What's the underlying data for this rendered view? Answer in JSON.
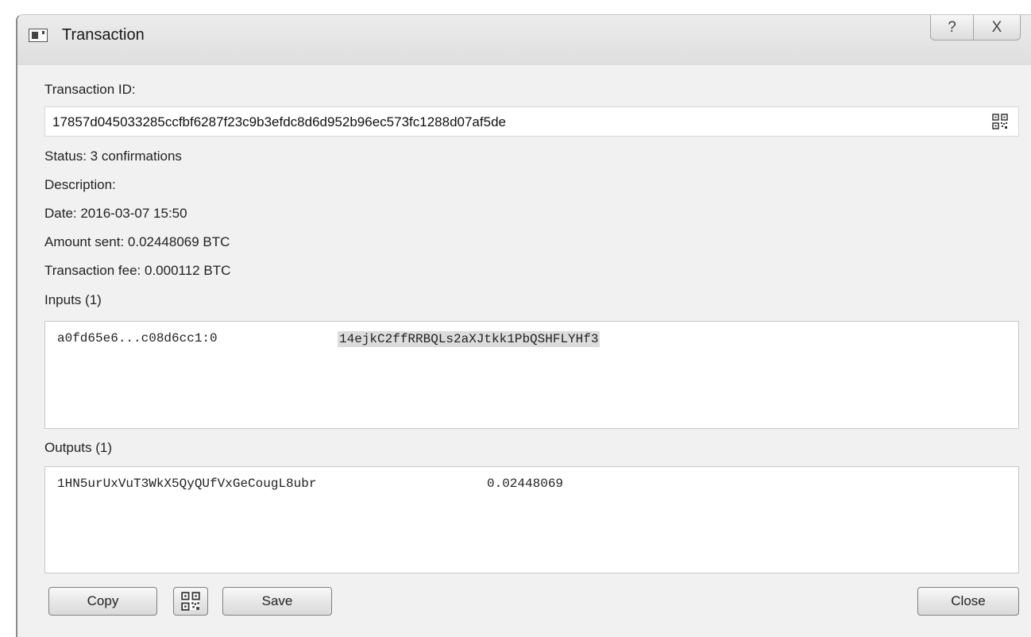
{
  "window": {
    "title": "Transaction"
  },
  "titlebar": {
    "help_glyph": "?",
    "close_glyph": "X"
  },
  "tx": {
    "id_label": "Transaction ID:",
    "id_value": "17857d045033285ccfbf6287f23c9b3efdc8d6d952b96ec573fc1288d07af5de",
    "status": "Status: 3 confirmations",
    "description": "Description:",
    "date": "Date: 2016-03-07 15:50",
    "amount_sent": "Amount sent: 0.02448069 BTC",
    "fee": "Transaction fee: 0.000112 BTC"
  },
  "inputs": {
    "label": "Inputs (1)",
    "rows": [
      {
        "prevout": "a0fd65e6...c08d6cc1:0",
        "address": "14ejkC2ffRRBQLs2aXJtkk1PbQSHFLYHf3"
      }
    ]
  },
  "outputs": {
    "label": "Outputs (1)",
    "rows": [
      {
        "address": "1HN5urUxVuT3WkX5QyQUfVxGeCougL8ubr",
        "amount": "0.02448069"
      }
    ]
  },
  "buttons": {
    "copy": "Copy",
    "save": "Save",
    "close": "Close"
  },
  "icons": {
    "app": "window-icon",
    "qr": "qr-code-icon"
  }
}
